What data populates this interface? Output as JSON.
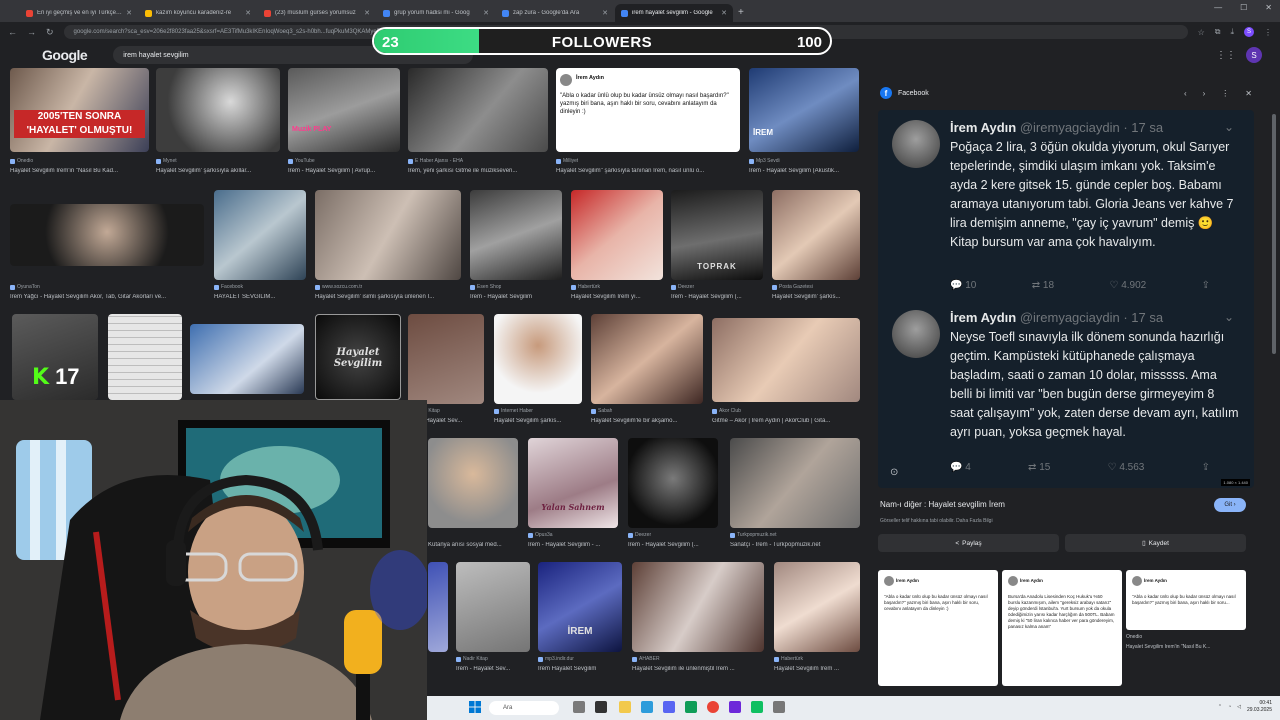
{
  "browser": {
    "tabs": [
      {
        "label": "En iyi geçmiş ve en iyi Türkçe şarkı",
        "color": "#ea4335"
      },
      {
        "label": "kazım koyuncu karadeniz-re",
        "color": "#fbbc04"
      },
      {
        "label": "(23) müslüm gürses yorumsuz",
        "color": "#ea4335"
      },
      {
        "label": "grup yorum hadisi mi - Goog",
        "color": "#4285f4"
      },
      {
        "label": "zap zura - Google'da Ara",
        "color": "#4285f4"
      },
      {
        "label": "irem hayalet sevgilim - Google",
        "color": "#4285f4"
      }
    ],
    "new_tab": "+",
    "url": "google.com/search?sca_esv=206e2f8023faa25&sxsrf=AE3TifMu3kIKEnIoqWoeq3_s2s-h0bh...fuqPkuM3QKAMyeRJaFSHNuqh...MbaQf8EKe7e...",
    "window_controls": [
      "—",
      "☐",
      "✕"
    ]
  },
  "google": {
    "logo": "Google",
    "query": "irem hayalet sevgilim",
    "avatar_letter": "S"
  },
  "followers": {
    "current": "23",
    "label": "FOLLOWERS",
    "goal": "100",
    "progress": 0.23
  },
  "kick": {
    "icon": "K",
    "count": "17"
  },
  "grid": [
    {
      "src": "Onedio",
      "cap": "Hayalet Sevgilim İrem'in \"Nasıl Bu Kad...",
      "overlay": "2005'TEN SONRA 'HAYALET' OLMUŞTU!"
    },
    {
      "src": "Mynet",
      "cap": "Hayalet Sevgilim' şarkısıyla akıllar...",
      "overlay": ""
    },
    {
      "src": "YouTube",
      "cap": "İrem - Hayalet Sevgilim | Avrup...",
      "overlay": "Muzik PLAY"
    },
    {
      "src": "E Haber Ajansı - EHA",
      "cap": "İrem, yeni şarkısı Gitme ile müzikseveri...",
      "overlay": ""
    },
    {
      "src": "Milliyet",
      "cap": "Hayalet Sevgilim\" şarkısıyla tanınan İrem, nasıl ünlü o...",
      "overlay": ""
    },
    {
      "src": "Mp3 Sevdi",
      "cap": "İrem - Hayalet Sevgilim (Akustik...",
      "overlay": "İREM"
    },
    {
      "src": "OyunaTon",
      "cap": "İrem Yağcı - Hayalet Sevgilim Akor, Tab, Gitar Akorları ve...",
      "overlay": ""
    },
    {
      "src": "Facebook",
      "cap": "HAYALET SEVGİLİM...",
      "overlay": ""
    },
    {
      "src": "www.sozcu.com.tr",
      "cap": "Hayalet Sevgilim' isimli şarkısıyla ünlenen İ...",
      "overlay": ""
    },
    {
      "src": "Esen Shop",
      "cap": "İrem - Hayalet Sevgilim",
      "overlay": ""
    },
    {
      "src": "Habertürk",
      "cap": "Hayalet Sevgilim İrem yı...",
      "overlay": ""
    },
    {
      "src": "Deezer",
      "cap": "İrem - Hayalet Sevgilim (...",
      "overlay": "TOPRAK"
    },
    {
      "src": "Posta Gazetesi",
      "cap": "Hayalet Sevgilim' şarkıs...",
      "overlay": ""
    },
    {
      "src": "Nadir Kitap",
      "cap": "İrem - Hayalet Sev...",
      "overlay": ""
    },
    {
      "src": "Internet Haber",
      "cap": "Hayalet Sevgilim şarkıs...",
      "overlay": ""
    },
    {
      "src": "Sabah",
      "cap": "Hayalet Sevgilim'le bir akşamo...",
      "overlay": ""
    },
    {
      "src": "Akor Club",
      "cap": "Gitme – Akor | İrem Aydın | AkorClub | Gita...",
      "overlay": ""
    },
    {
      "src": "",
      "cap": "Kütanya anısı sosyal med...",
      "overlay": ""
    },
    {
      "src": "Opus3a",
      "cap": "İrem - Hayalet Sevgilim - ...",
      "overlay": "Yalan Sahnem"
    },
    {
      "src": "Deezer",
      "cap": "İrem - Hayalet Sevgilim (...",
      "overlay": ""
    },
    {
      "src": "Turkpopmuzik.net",
      "cap": "Sanatçı - İrem - Turkpopmuzik.net",
      "overlay": ""
    },
    {
      "src": "Nadir Kitap",
      "cap": "İrem - Hayalet Sev...",
      "overlay": ""
    },
    {
      "src": "mp3.indir.dur",
      "cap": "İrem Hayalet Sevgilim",
      "overlay": "İREM"
    },
    {
      "src": "AHABER",
      "cap": "Hayalet Sevgilim ile ünlenmiştil İrem ...",
      "overlay": ""
    },
    {
      "src": "Habertürk",
      "cap": "Hayalet Sevgilim İrem ...",
      "overlay": ""
    }
  ],
  "grid_quote": {
    "name": "İrem Aydın",
    "text": "\"Abla o kadar ünlü olup bu kadar ünsüz olmayı nasıl başardın?\" yazmış biri bana, aşırı haklı bir soru, cevabını anlatayım da dinleyin :)"
  },
  "hayalet_title": "Hayalet Sevgilim",
  "panel": {
    "source": "Facebook",
    "nav": [
      "‹",
      "›",
      "⋮",
      "✕"
    ],
    "tweets": [
      {
        "name": "İrem Aydın",
        "handle": "@iremyagciaydin · 17 sa",
        "text": "Poğaça 2 lira, 3 öğün okulda yiyorum, okul Sarıyer tepelerinde, şimdiki ulaşım imkanı yok. Taksim'e ayda 2 kere gitsek 15. günde cepler boş. Babamı aramaya utanıyorum tabi. Gloria Jeans ver kahve 7 lira demişim anneme, \"çay iç yavrum\" demiş 🙂 Kitap bursum var ama çok havalıyım.",
        "replies": "10",
        "retweets": "18",
        "likes": "4.902"
      },
      {
        "name": "İrem Aydın",
        "handle": "@iremyagciaydin · 17 sa",
        "text": "Neyse Toefl sınavıyla ilk dönem sonunda hazırlığı geçtim. Kampüsteki kütüphanede çalışmaya başladım, saati o zaman 10 dolar, misssss. Ama belli bi limiti var \"ben bugün derse girmeyeyim 8 saat çalışayım\" yok, zaten derse devam ayrı, katılım ayrı puan, yoksa geçmek hayal.",
        "replies": "4",
        "retweets": "15",
        "likes": "4.563"
      }
    ],
    "dims": "1.080 × 1.440",
    "title": "Nam-ı diğer : Hayalet sevgilim İrem",
    "visit_label": "Git ›",
    "subtitle": "Görseller telif hakkına tabi olabilir. Daha Fazla Bilgi",
    "share_label": "Paylaş",
    "save_label": "Kaydet",
    "related": [
      {
        "name": "İrem Aydın",
        "text": "\"Abla o kadar ünlü olup bu kadar ünsüz olmayı nasıl başardın?\" yazmış biri bana, aşırı haklı bir soru, cevabını anlatayım da dinleyin :)",
        "cap": ""
      },
      {
        "name": "İrem Aydın",
        "text": "Bursa'da Anadolu Lisesinden Koç Hukuk'u %50 burslu kazanmışım, ailem \"gereksiz arabayı satarız\" deyip gönderdi İstanbul'a. Yurt bursum yok da okula ödediğimizin yarısı kadar harçlığım da 500TL. Babam demiş ki \"50 liran kalınca haber ver para göndereyim, panasız kalma anam\"",
        "cap": ""
      },
      {
        "name": "İrem Aydın",
        "text": "\"Abla o kadar ünlü olup bu kadar ünsüz olmayı nasıl başardın?\" yazmış biri bana, aşırı haklı bir soru...",
        "cap": "Hayalet Sevgilim İrem'in \"Nasıl Bu K..."
      }
    ],
    "related_src": "Onedio"
  },
  "taskbar": {
    "search_placeholder": "Ara",
    "time": "00:41",
    "date": "29.03.2025"
  },
  "colors": {
    "page_bg": "#202124",
    "tweet_bg": "#15202b",
    "follower_fill": "#2ecc71",
    "kick_green": "#53fc18",
    "accent_blue": "#8ab4f8"
  }
}
